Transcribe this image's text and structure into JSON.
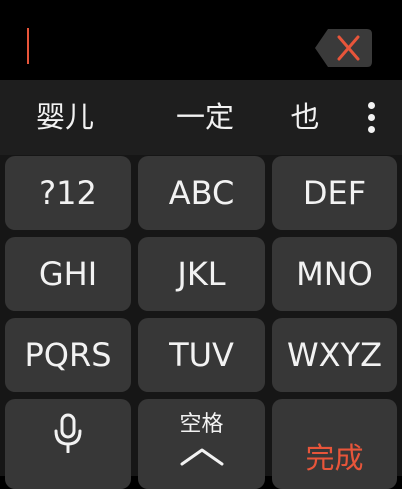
{
  "input": {
    "text": ""
  },
  "candidates": [
    "婴儿",
    "一定",
    "也"
  ],
  "keys": {
    "row1": [
      "?12",
      "ABC",
      "DEF"
    ],
    "row2": [
      "GHI",
      "JKL",
      "MNO"
    ],
    "row3": [
      "PQRS",
      "TUV",
      "WXYZ"
    ],
    "space_label": "空格",
    "done_label": "完成"
  },
  "icons": {
    "delete": "backspace-x-icon",
    "more": "more-vertical-icon",
    "mic": "microphone-icon",
    "space_chevron": "chevron-up-icon"
  },
  "colors": {
    "accent": "#e8553a",
    "key_bg": "#373737",
    "keyboard_bg": "#161616",
    "candidate_bar_bg": "#1e1e1e",
    "text": "#f2f2f2"
  }
}
